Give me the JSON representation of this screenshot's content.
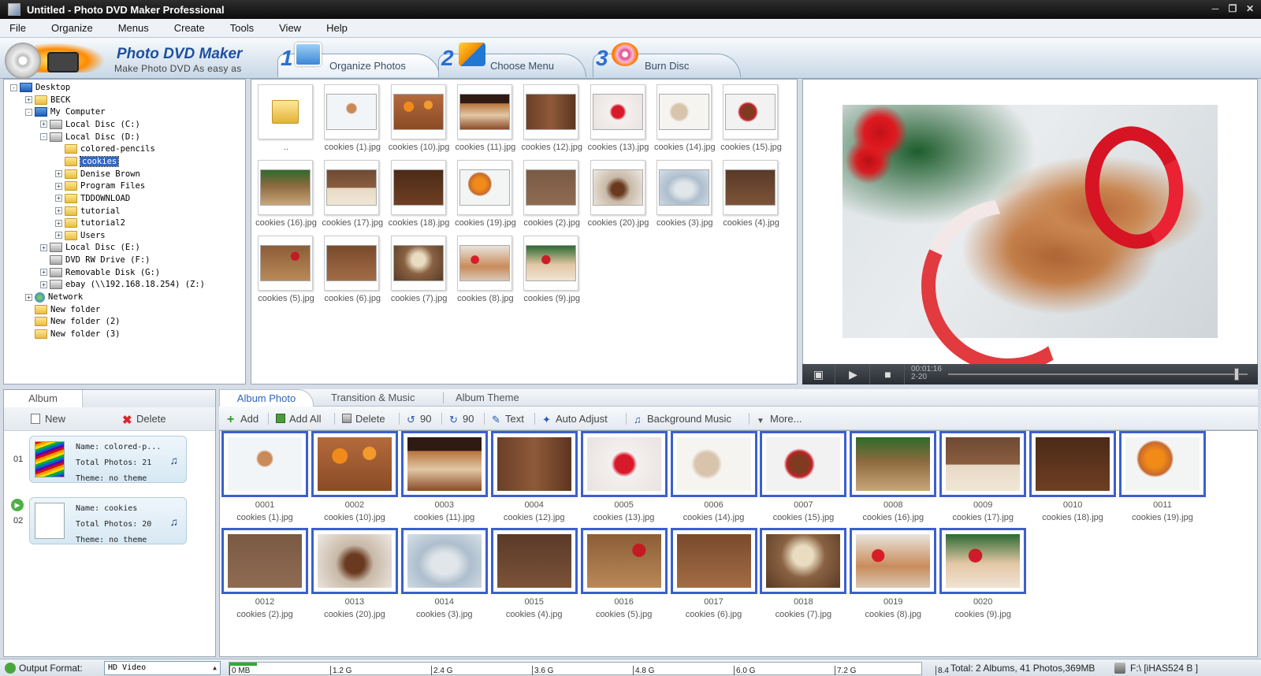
{
  "window": {
    "title": "Untitled - Photo DVD Maker Professional"
  },
  "menu": [
    "File",
    "Organize",
    "Menus",
    "Create",
    "Tools",
    "View",
    "Help"
  ],
  "brand": {
    "name": "Photo DVD Maker",
    "tagline": "Make Photo DVD As easy as"
  },
  "steps": [
    {
      "num": "1",
      "label": "Organize Photos"
    },
    {
      "num": "2",
      "label": "Choose Menu"
    },
    {
      "num": "3",
      "label": "Burn Disc"
    }
  ],
  "tree": [
    {
      "label": "Desktop",
      "icon": "pc-icon",
      "exp": "-"
    },
    {
      "label": "BECK",
      "icon": "folder-icon",
      "exp": "+"
    },
    {
      "label": "My Computer",
      "icon": "pc-icon",
      "exp": "-"
    },
    {
      "label": "Local Disc  (C:)",
      "icon": "disk-icon",
      "exp": "+"
    },
    {
      "label": "Local Disc  (D:)",
      "icon": "disk-icon",
      "exp": "-"
    },
    {
      "label": "colored-pencils",
      "icon": "folder-icon",
      "exp": ""
    },
    {
      "label": "cookies",
      "icon": "folder-icon",
      "exp": "",
      "selected": true
    },
    {
      "label": "Denise Brown",
      "icon": "folder-icon",
      "exp": "+"
    },
    {
      "label": "Program Files",
      "icon": "folder-icon",
      "exp": "+"
    },
    {
      "label": "TDDOWNLOAD",
      "icon": "folder-icon",
      "exp": "+"
    },
    {
      "label": "tutorial",
      "icon": "folder-icon",
      "exp": "+"
    },
    {
      "label": "tutorial2",
      "icon": "folder-icon",
      "exp": "+"
    },
    {
      "label": "Users",
      "icon": "folder-icon",
      "exp": "+"
    },
    {
      "label": "Local Disc  (E:)",
      "icon": "disk-icon",
      "exp": "+"
    },
    {
      "label": "DVD RW Drive  (F:)",
      "icon": "disk-icon",
      "exp": ""
    },
    {
      "label": "Removable Disk  (G:)",
      "icon": "disk-icon",
      "exp": "+"
    },
    {
      "label": "ebay  (\\\\192.168.18.254)  (Z:)",
      "icon": "disk-icon",
      "exp": "+"
    },
    {
      "label": "Network",
      "icon": "network-icon",
      "exp": "+"
    },
    {
      "label": "New folder",
      "icon": "folder-icon",
      "exp": ""
    },
    {
      "label": "New folder  (2)",
      "icon": "folder-icon",
      "exp": ""
    },
    {
      "label": "New folder  (3)",
      "icon": "folder-icon",
      "exp": ""
    }
  ],
  "browser": {
    "items": [
      {
        "caption": "..",
        "photo": "folder"
      },
      {
        "caption": "cookies (1).jpg",
        "photo": "p1"
      },
      {
        "caption": "cookies (10).jpg",
        "photo": "p2"
      },
      {
        "caption": "cookies (11).jpg",
        "photo": "p3"
      },
      {
        "caption": "cookies (12).jpg",
        "photo": "p4"
      },
      {
        "caption": "cookies (13).jpg",
        "photo": "p5"
      },
      {
        "caption": "cookies (14).jpg",
        "photo": "p6"
      },
      {
        "caption": "cookies (15).jpg",
        "photo": "p7"
      },
      {
        "caption": "cookies (16).jpg",
        "photo": "p8"
      },
      {
        "caption": "cookies (17).jpg",
        "photo": "p9"
      },
      {
        "caption": "cookies (18).jpg",
        "photo": "p10"
      },
      {
        "caption": "cookies (19).jpg",
        "photo": "p11"
      },
      {
        "caption": "cookies (2).jpg",
        "photo": "p12"
      },
      {
        "caption": "cookies (20).jpg",
        "photo": "p13"
      },
      {
        "caption": "cookies (3).jpg",
        "photo": "p14"
      },
      {
        "caption": "cookies (4).jpg",
        "photo": "p15"
      },
      {
        "caption": "cookies (5).jpg",
        "photo": "p16"
      },
      {
        "caption": "cookies (6).jpg",
        "photo": "p17"
      },
      {
        "caption": "cookies (7).jpg",
        "photo": "p18"
      },
      {
        "caption": "cookies (8).jpg",
        "photo": "p19"
      },
      {
        "caption": "cookies (9).jpg",
        "photo": "p20"
      }
    ]
  },
  "player": {
    "time": "00:01:16",
    "slide": "2-20"
  },
  "album_panel": {
    "tab": "Album",
    "new_label": "New",
    "delete_label": "Delete",
    "albums": [
      {
        "index": "01",
        "name_line": "Name: colored-p...",
        "photos_line": "Total Photos: 21",
        "theme_line": "Theme: no theme"
      },
      {
        "index": "02",
        "name_line": "Name: cookies",
        "photos_line": "Total Photos: 20",
        "theme_line": "Theme: no theme"
      }
    ]
  },
  "tabs": [
    "Album Photo",
    "Transition & Music",
    "Album Theme"
  ],
  "toolbar": {
    "add": "Add",
    "add_all": "Add All",
    "delete": "Delete",
    "rot_left": "90",
    "rot_right": "90",
    "text": "Text",
    "auto_adjust": "Auto Adjust",
    "bg_music": "Background Music",
    "more": "More..."
  },
  "album_photos": [
    {
      "num": "0001",
      "caption": "cookies (1).jpg",
      "photo": "p1"
    },
    {
      "num": "0002",
      "caption": "cookies (10).jpg",
      "photo": "p2"
    },
    {
      "num": "0003",
      "caption": "cookies (11).jpg",
      "photo": "p3"
    },
    {
      "num": "0004",
      "caption": "cookies (12).jpg",
      "photo": "p4"
    },
    {
      "num": "0005",
      "caption": "cookies (13).jpg",
      "photo": "p5"
    },
    {
      "num": "0006",
      "caption": "cookies (14).jpg",
      "photo": "p6"
    },
    {
      "num": "0007",
      "caption": "cookies (15).jpg",
      "photo": "p7"
    },
    {
      "num": "0008",
      "caption": "cookies (16).jpg",
      "photo": "p8"
    },
    {
      "num": "0009",
      "caption": "cookies (17).jpg",
      "photo": "p9"
    },
    {
      "num": "0010",
      "caption": "cookies (18).jpg",
      "photo": "p10"
    },
    {
      "num": "0011",
      "caption": "cookies (19).jpg",
      "photo": "p11"
    },
    {
      "num": "0012",
      "caption": "cookies (2).jpg",
      "photo": "p12"
    },
    {
      "num": "0013",
      "caption": "cookies (20).jpg",
      "photo": "p13"
    },
    {
      "num": "0014",
      "caption": "cookies (3).jpg",
      "photo": "p14"
    },
    {
      "num": "0015",
      "caption": "cookies (4).jpg",
      "photo": "p15"
    },
    {
      "num": "0016",
      "caption": "cookies (5).jpg",
      "photo": "p16"
    },
    {
      "num": "0017",
      "caption": "cookies (6).jpg",
      "photo": "p17"
    },
    {
      "num": "0018",
      "caption": "cookies (7).jpg",
      "photo": "p18"
    },
    {
      "num": "0019",
      "caption": "cookies (8).jpg",
      "photo": "p19"
    },
    {
      "num": "0020",
      "caption": "cookies (9).jpg",
      "photo": "p20"
    }
  ],
  "status": {
    "output_label": "Output Format:",
    "output_value": "HD Video",
    "capacity_ticks": [
      "0 MB",
      "1.2 G",
      "2.4 G",
      "3.6 G",
      "4.8 G",
      "6.0 G",
      "7.2 G",
      "8.4 G"
    ],
    "capacity_used_fraction": 0.04,
    "total": "Total: 2 Albums, 41 Photos,369MB",
    "drive": "F:\\ [iHAS524   B     ]"
  }
}
